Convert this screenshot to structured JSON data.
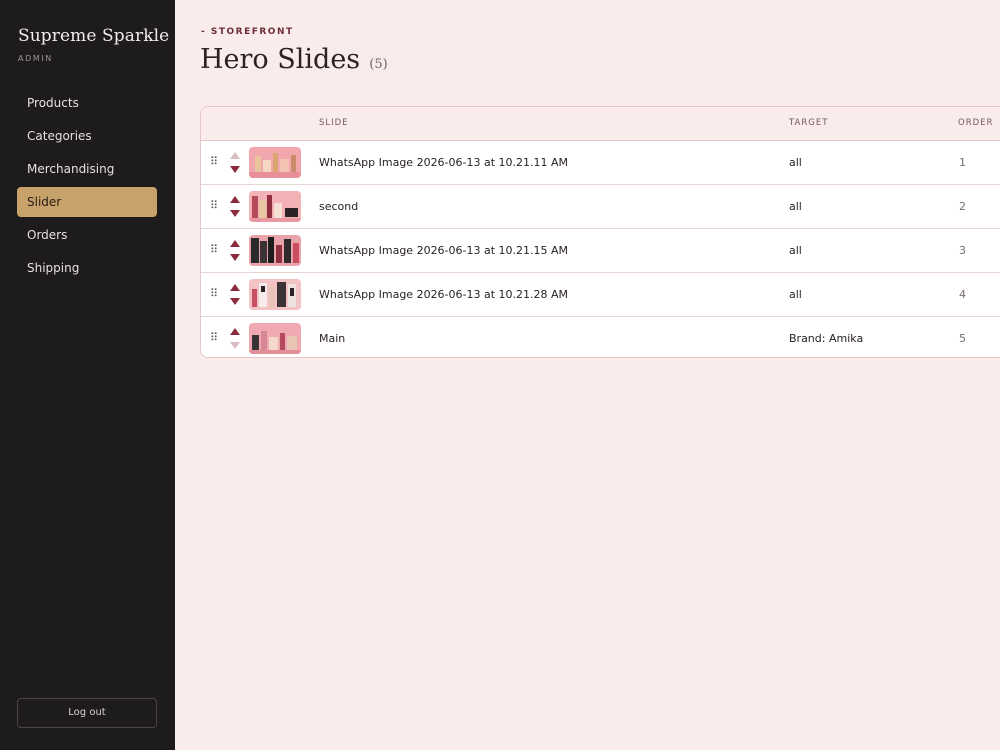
{
  "sidebar": {
    "brand": "Supreme Sparkle",
    "brand_sub": "ADMIN",
    "items": [
      {
        "label": "Products"
      },
      {
        "label": "Categories"
      },
      {
        "label": "Merchandising"
      },
      {
        "label": "Slider",
        "active": true
      },
      {
        "label": "Orders"
      },
      {
        "label": "Shipping"
      }
    ],
    "logout_label": "Log out"
  },
  "header": {
    "eyebrow": "- STOREFRONT",
    "title": "Hero Slides",
    "count": "(5)"
  },
  "table": {
    "columns": {
      "slide": "SLIDE",
      "target": "TARGET",
      "order": "ORDER"
    },
    "rows": [
      {
        "slide": "WhatsApp Image 2026-06-13 at 10.21.11 AM",
        "target": "all",
        "order": "1",
        "up_disabled": true,
        "down_disabled": false
      },
      {
        "slide": "second",
        "target": "all",
        "order": "2",
        "up_disabled": false,
        "down_disabled": false
      },
      {
        "slide": "WhatsApp Image 2026-06-13 at 10.21.15 AM",
        "target": "all",
        "order": "3",
        "up_disabled": false,
        "down_disabled": false
      },
      {
        "slide": "WhatsApp Image 2026-06-13 at 10.21.28 AM",
        "target": "all",
        "order": "4",
        "up_disabled": false,
        "down_disabled": false
      },
      {
        "slide": "Main",
        "target": "Brand: Amika",
        "order": "5",
        "up_disabled": false,
        "down_disabled": true
      }
    ]
  },
  "colors": {
    "sidebar_bg": "#1e1b1c",
    "accent": "#c8a26b",
    "page_bg": "#fbecec",
    "maroon": "#8a2a3c"
  }
}
